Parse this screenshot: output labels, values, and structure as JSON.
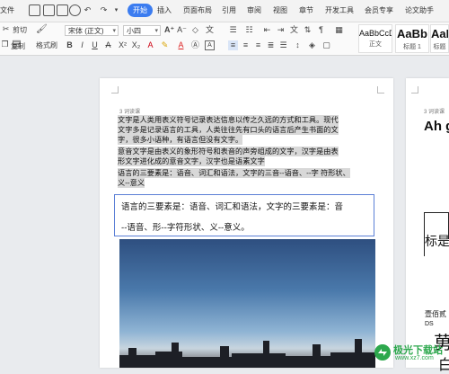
{
  "menu": {
    "file": "文件",
    "tabs": [
      "开始",
      "插入",
      "页面布局",
      "引用",
      "审阅",
      "视图",
      "章节",
      "开发工具",
      "会员专享",
      "论文助手"
    ]
  },
  "toolbar": {
    "cut": "剪切",
    "copy": "复制",
    "paste_format": "格式刷",
    "font_name": "宋体 (正文)",
    "font_size": "小四",
    "styles": [
      {
        "sample": "AaBbCcD",
        "name": "正文"
      },
      {
        "sample": "AaBb",
        "name": "标题 1"
      },
      {
        "sample": "AaBl",
        "name": "标题"
      }
    ]
  },
  "page1": {
    "header_label": "3 词读课",
    "para1_lines": [
      "文字是人类用表义符号记录表达信息以传之久远的方式和工具。现代",
      "文字多是记录语言的工具，人类往往先有口头的语言后产生书面的文",
      "字，很多小语种，有语言但没有文字。"
    ],
    "para2_lines": [
      "意音文字是由表义的象形符号和表音的声旁组成的文字，汉字是由表",
      "形文字进化成的意音文字，汉字也是语素文字"
    ],
    "para3_lines": [
      "语言的三要素是：语音、词汇和语法，文字的三音--语音、--字 符形状、",
      "义--意义"
    ],
    "box_lines": [
      "语言的三要素是：语音、词汇和语法，文字的三要素是：音",
      "--语音、形--字符形状、义--意义。"
    ]
  },
  "page2": {
    "header_label": "3 词读课",
    "heading": "Ah g",
    "title": "标是",
    "small_text1": "壹佰贰",
    "small_text2": "DS",
    "large_char1": "莮",
    "large_char2": "白"
  },
  "watermark": {
    "line1": "极光下载站",
    "line2": "www.xz7.com"
  },
  "colors": {
    "accent": "#3b7cf0",
    "highlight": "#d8d8d8",
    "box_border": "#5b7fd6",
    "watermark_green": "#2da84d"
  }
}
